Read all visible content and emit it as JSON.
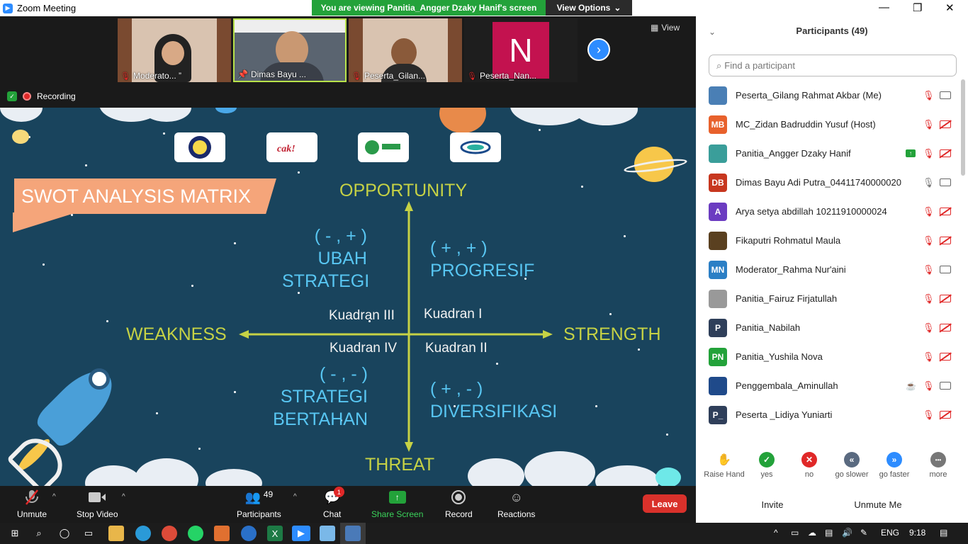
{
  "window": {
    "title": "Zoom Meeting"
  },
  "share_banner": {
    "text": "You are viewing Panitia_Angger Dzaky Hanif's screen",
    "view_options": "View Options"
  },
  "gallery": {
    "thumbs": [
      {
        "label": "Moderato... ”"
      },
      {
        "label": "Dimas Bayu ..."
      },
      {
        "label": "Peserta_Gilan..."
      },
      {
        "label": "Peserta_Nan...",
        "initial": "N"
      }
    ],
    "view_label": "View",
    "recording_label": "Recording"
  },
  "slide": {
    "title": "SWOT ANALYSIS MATRIX",
    "axes": {
      "top": "OPPORTUNITY",
      "bottom": "THREAT",
      "left": "WEAKNESS",
      "right": "STRENGTH"
    },
    "q2": {
      "sign": "( - , + )",
      "l1": "UBAH",
      "l2": "STRATEGI"
    },
    "q1": {
      "sign": "( + , + )",
      "l1": "PROGRESIF"
    },
    "q3": {
      "sign": "( - , - )",
      "l1": "STRATEGI",
      "l2": "BERTAHAN"
    },
    "q4": {
      "sign": "( + , - )",
      "l1": "DIVERSIFIKASI"
    },
    "kuadran": {
      "k3": "Kuadran III",
      "k1": "Kuadran I",
      "k4": "Kuadran IV",
      "k2": "Kuadran II"
    }
  },
  "toolbar": {
    "unmute": "Unmute",
    "stop_video": "Stop Video",
    "participants": "Participants",
    "participants_count": "49",
    "chat": "Chat",
    "chat_badge": "1",
    "share_screen": "Share Screen",
    "record": "Record",
    "reactions": "Reactions",
    "leave": "Leave"
  },
  "panel": {
    "header": "Participants (49)",
    "search_placeholder": "Find a participant",
    "participants": [
      {
        "name": "Peserta_Gilang Rahmat Akbar (Me)",
        "avatar": "",
        "color": "#4a7fb5",
        "video": "on"
      },
      {
        "name": "MC_Zidan Badruddin Yusuf (Host)",
        "avatar": "MB",
        "color": "#e8612c",
        "video": "off"
      },
      {
        "name": "Panitia_Angger Dzaky Hanif",
        "avatar": "",
        "color": "#3a9e9a",
        "video": "off",
        "sharing": true
      },
      {
        "name": "Dimas Bayu Adi Putra_04411740000020",
        "avatar": "DB",
        "color": "#c7371f",
        "video": "on",
        "mic": "on"
      },
      {
        "name": "Arya setya abdillah 10211910000024",
        "avatar": "A",
        "color": "#6b3cc1",
        "video": "off"
      },
      {
        "name": "Fikaputri Rohmatul Maula",
        "avatar": "",
        "color": "#5a4020",
        "video": "off"
      },
      {
        "name": "Moderator_Rahma Nur'aini",
        "avatar": "MN",
        "color": "#2b7fc5",
        "video": "on"
      },
      {
        "name": "Panitia_Fairuz Firjatullah",
        "avatar": "",
        "color": "#999",
        "video": "off"
      },
      {
        "name": "Panitia_Nabilah",
        "avatar": "P",
        "color": "#2f3f5a",
        "video": "off"
      },
      {
        "name": "Panitia_Yushila Nova",
        "avatar": "PN",
        "color": "#23a23a",
        "video": "off"
      },
      {
        "name": "Penggembala_Aminullah",
        "avatar": "",
        "color": "#1f4a8a",
        "video": "on",
        "cup": true
      },
      {
        "name": "Peserta _Lidiya Yuniarti",
        "avatar": "P_",
        "color": "#2f3f5a",
        "video": "off"
      }
    ],
    "reactions": [
      {
        "label": "Raise Hand",
        "color": "#2d8cff",
        "glyph": "✋"
      },
      {
        "label": "yes",
        "color": "#23a23a",
        "glyph": "✓"
      },
      {
        "label": "no",
        "color": "#e02828",
        "glyph": "✕"
      },
      {
        "label": "go slower",
        "color": "#5a6a80",
        "glyph": "«"
      },
      {
        "label": "go faster",
        "color": "#2d8cff",
        "glyph": "»"
      },
      {
        "label": "more",
        "color": "#777",
        "glyph": "•••"
      }
    ],
    "invite": "Invite",
    "unmute_me": "Unmute Me"
  },
  "taskbar": {
    "lang": "ENG",
    "time": "9:18"
  }
}
